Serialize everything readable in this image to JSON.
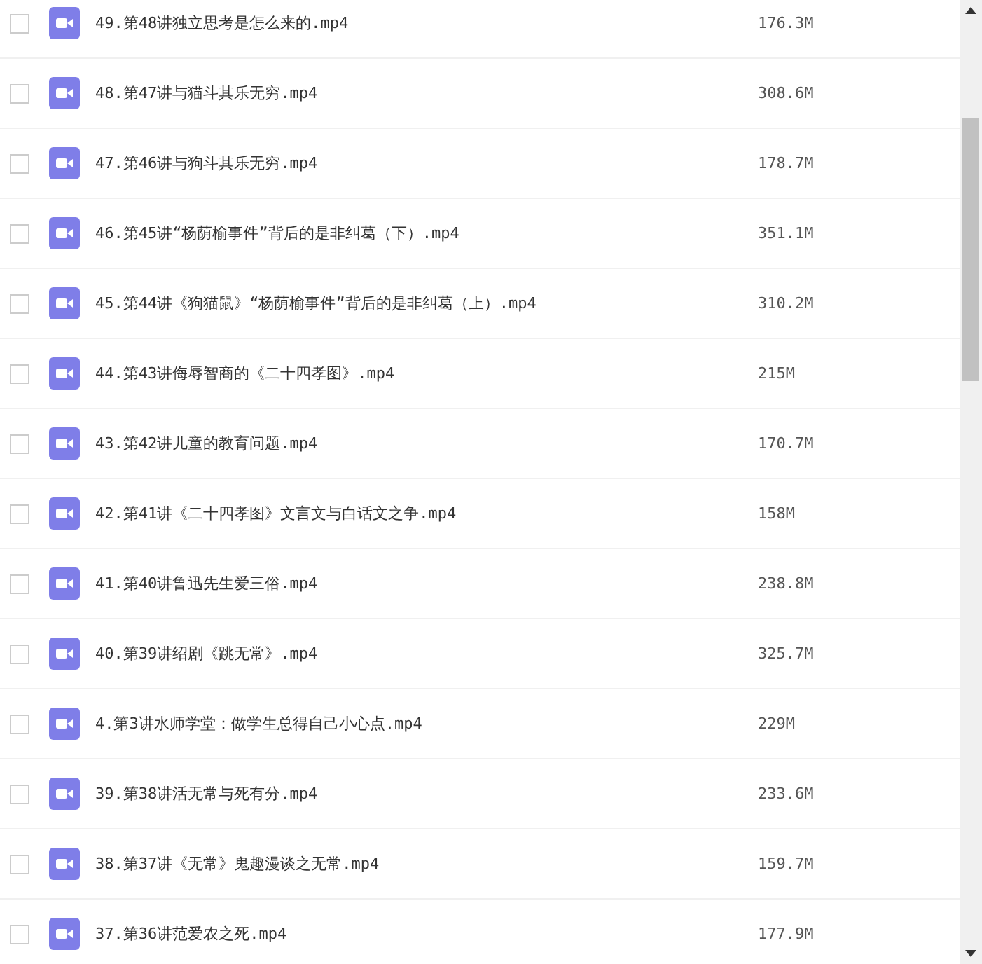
{
  "files": [
    {
      "name": "49.第48讲独立思考是怎么来的.mp4",
      "size": "176.3M",
      "checked": false
    },
    {
      "name": "48.第47讲与猫斗其乐无穷.mp4",
      "size": "308.6M",
      "checked": false
    },
    {
      "name": "47.第46讲与狗斗其乐无穷.mp4",
      "size": "178.7M",
      "checked": false
    },
    {
      "name": "46.第45讲“杨荫榆事件”背后的是非纠葛（下）.mp4",
      "size": "351.1M",
      "checked": false
    },
    {
      "name": "45.第44讲《狗猫鼠》“杨荫榆事件”背后的是非纠葛（上）.mp4",
      "size": "310.2M",
      "checked": false
    },
    {
      "name": "44.第43讲侮辱智商的《二十四孝图》.mp4",
      "size": "215M",
      "checked": false
    },
    {
      "name": "43.第42讲儿童的教育问题.mp4",
      "size": "170.7M",
      "checked": false
    },
    {
      "name": "42.第41讲《二十四孝图》文言文与白话文之争.mp4",
      "size": "158M",
      "checked": false
    },
    {
      "name": "41.第40讲鲁迅先生爱三俗.mp4",
      "size": "238.8M",
      "checked": false
    },
    {
      "name": "40.第39讲绍剧《跳无常》.mp4",
      "size": "325.7M",
      "checked": false
    },
    {
      "name": "4.第3讲水师学堂：做学生总得自己小心点.mp4",
      "size": "229M",
      "checked": false
    },
    {
      "name": "39.第38讲活无常与死有分.mp4",
      "size": "233.6M",
      "checked": false
    },
    {
      "name": "38.第37讲《无常》鬼趣漫谈之无常.mp4",
      "size": "159.7M",
      "checked": false
    },
    {
      "name": "37.第36讲范爱农之死.mp4",
      "size": "177.9M",
      "checked": false
    }
  ]
}
